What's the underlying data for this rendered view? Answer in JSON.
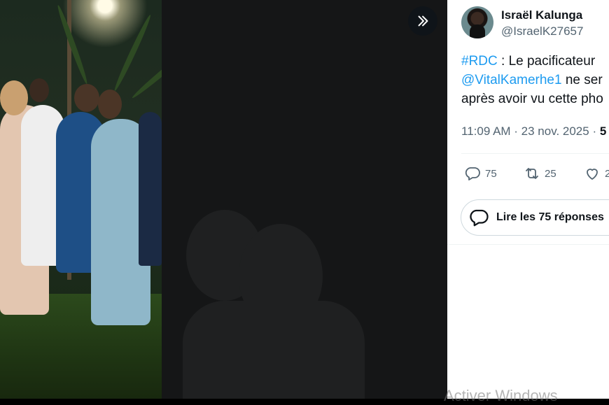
{
  "media": {
    "image_label": "",
    "next_button_icon": "chevron-double-right-icon"
  },
  "tweet": {
    "author": {
      "display_name": "Israël Kalunga",
      "handle": "@IsraelK27657"
    },
    "text_lines": [
      {
        "hashtag": "#RDC",
        "rest": " : Le pacificateur"
      },
      {
        "mention": "@VitalKamerhe1",
        "rest": " ne ser"
      },
      {
        "plain": "après avoir vu cette pho"
      }
    ],
    "timestamp": "11:09 AM · 23 nov. 2025 · ",
    "views_fragment": "5",
    "actions": {
      "reply_count": "75",
      "retweet_count": "25",
      "like_count": "2"
    },
    "read_replies_label": "Lire les 75 réponses"
  },
  "system": {
    "watermark": "Activer Windows"
  },
  "colors": {
    "link": "#1d9bf0",
    "text_primary": "#0f1419",
    "text_secondary": "#536471",
    "border": "#cfd9de"
  }
}
